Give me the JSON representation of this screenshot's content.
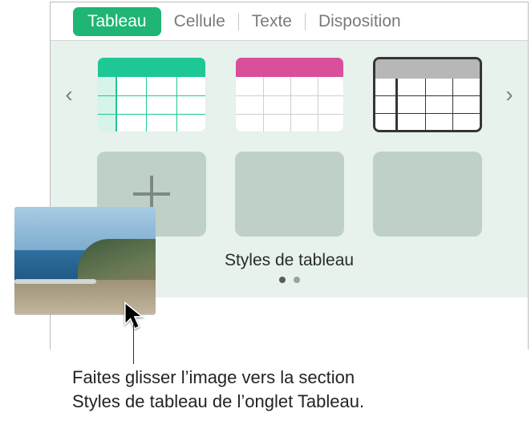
{
  "tabs": {
    "tableau": "Tableau",
    "cellule": "Cellule",
    "texte": "Texte",
    "disposition": "Disposition"
  },
  "styles": {
    "section_title": "Styles de tableau",
    "thumbs": [
      {
        "name": "teal-header-style",
        "header_color": "#1ec796"
      },
      {
        "name": "pink-header-style",
        "header_color": "#d94f9b"
      },
      {
        "name": "gray-bold-border-style",
        "header_color": "#b7b7b7"
      }
    ],
    "add_label": "add-style"
  },
  "icons": {
    "chevron_left": "‹",
    "chevron_right": "›",
    "plus": "+"
  },
  "pagination": {
    "page_count": 2,
    "active_index": 0
  },
  "drag_hint": {
    "line1": "Faites glisser l’image vers la section",
    "line2": "Styles de tableau de l’onglet Tableau."
  }
}
